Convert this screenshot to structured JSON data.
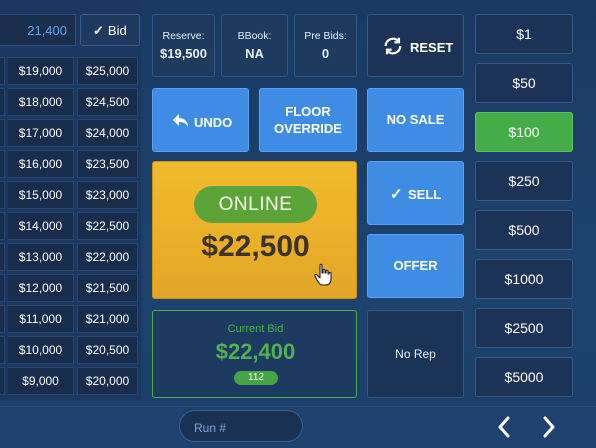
{
  "left_panel": {
    "bid_value": "21,400",
    "bid_button_label": "Bid",
    "rows": [
      {
        "low": "$19,000",
        "high": "$25,000"
      },
      {
        "low": "$18,000",
        "high": "$24,500"
      },
      {
        "low": "$17,000",
        "high": "$24,000"
      },
      {
        "low": "$16,000",
        "high": "$23,500"
      },
      {
        "low": "$15,000",
        "high": "$23,000"
      },
      {
        "low": "$14,000",
        "high": "$22,500"
      },
      {
        "low": "$13,000",
        "high": "$22,000"
      },
      {
        "low": "$12,000",
        "high": "$21,500"
      },
      {
        "low": "$11,000",
        "high": "$21,000"
      },
      {
        "low": "$10,000",
        "high": "$20,500"
      },
      {
        "low": "$9,000",
        "high": "$20,000"
      }
    ]
  },
  "info": {
    "reserve_label": "Reserve:",
    "reserve_value": "$19,500",
    "bbook_label": "BBook:",
    "bbook_value": "NA",
    "prebids_label": "Pre Bids:",
    "prebids_value": "0"
  },
  "buttons": {
    "reset": "RESET",
    "undo": "UNDO",
    "floor_override_1": "FLOOR",
    "floor_override_2": "OVERRIDE",
    "no_sale": "NO SALE",
    "sell": "SELL",
    "offer": "OFFER",
    "no_rep": "No Rep"
  },
  "online": {
    "badge": "ONLINE",
    "amount": "$22,500"
  },
  "current_bid": {
    "label": "Current Bid",
    "amount": "$22,400",
    "bidder": "112"
  },
  "increments": [
    "$1",
    "$50",
    "$100",
    "$250",
    "$500",
    "$1000",
    "$2500",
    "$5000"
  ],
  "selected_increment": "$100",
  "bottom": {
    "run_placeholder": "Run #"
  },
  "colors": {
    "accent_blue": "#3f8ce4",
    "online_yellow": "#eab02a",
    "green": "#45ad48",
    "background": "#1b3d66"
  }
}
